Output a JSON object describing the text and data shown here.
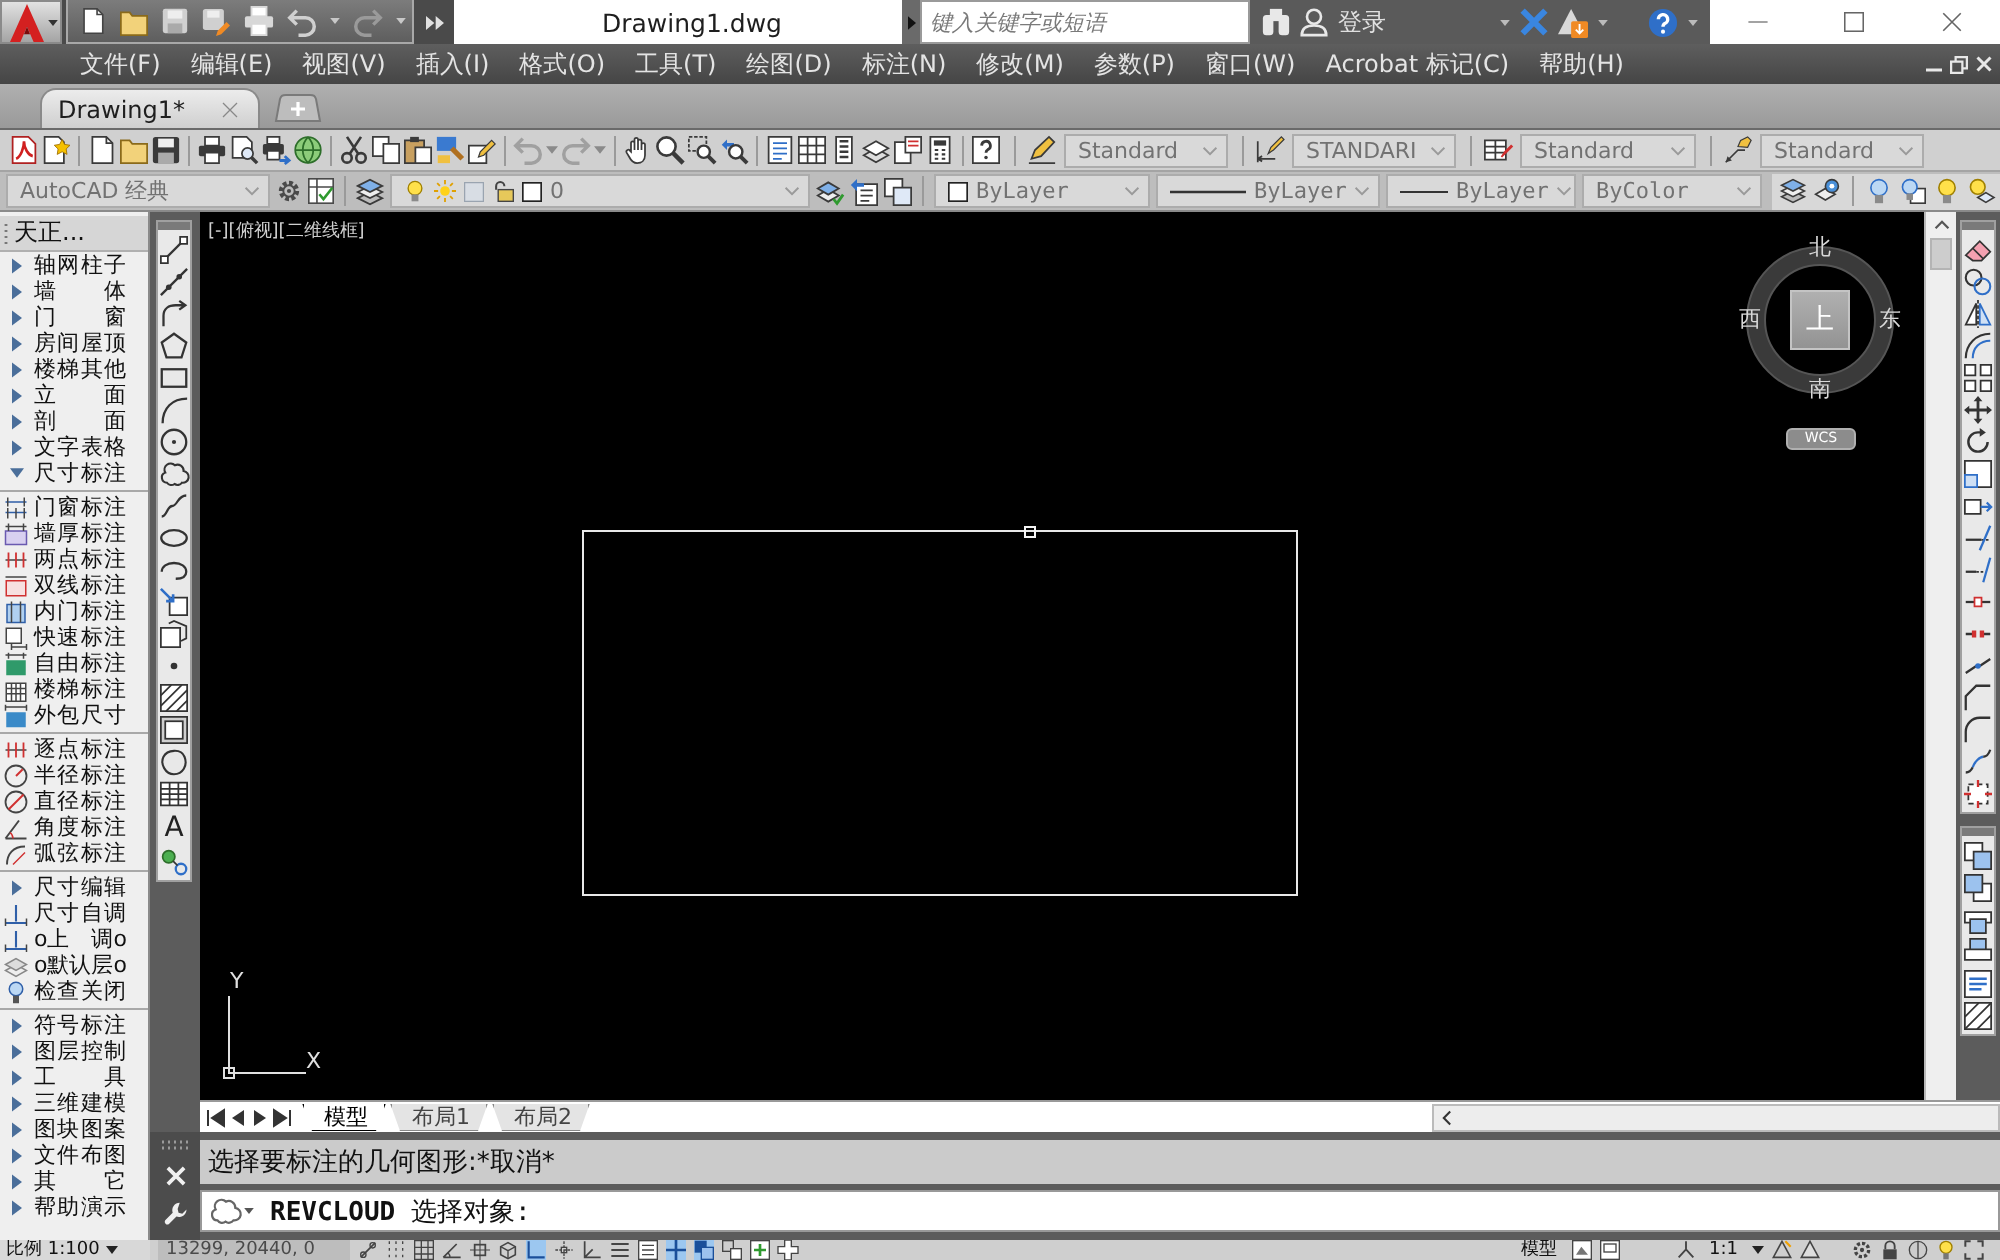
{
  "title_bar": {
    "document_title": "Drawing1.dwg",
    "search": {
      "placeholder": "键入关键字或短语"
    },
    "sign_in": "登录"
  },
  "menu_bar": [
    "文件(F)",
    "编辑(E)",
    "视图(V)",
    "插入(I)",
    "格式(O)",
    "工具(T)",
    "绘图(D)",
    "标注(N)",
    "修改(M)",
    "参数(P)",
    "窗口(W)",
    "Acrobat 标记(C)",
    "帮助(H)"
  ],
  "document_tabs": [
    {
      "label": "Drawing1*",
      "selected": true
    }
  ],
  "styles_toolbar": [
    {
      "kind": "text_style",
      "value": "Standard"
    },
    {
      "kind": "dimension_style",
      "value": "STANDARI"
    },
    {
      "kind": "table_style",
      "value": "Standard"
    },
    {
      "kind": "multileader_style",
      "value": "Standard"
    }
  ],
  "layers_toolbar": {
    "workspace": "AutoCAD 经典",
    "layer": "0",
    "color_setting": "ByLayer",
    "linetype": "ByLayer",
    "lineweight": "ByLayer",
    "plot_style": "ByColor"
  },
  "tianzheng_menu": {
    "title": "天正...",
    "items": [
      {
        "kind": "submenu",
        "label": "轴网柱子",
        "expanded": false
      },
      {
        "kind": "submenu",
        "label": "墙　体",
        "expanded": false
      },
      {
        "kind": "submenu",
        "label": "门　窗",
        "expanded": false
      },
      {
        "kind": "submenu",
        "label": "房间屋顶",
        "expanded": false
      },
      {
        "kind": "submenu",
        "label": "楼梯其他",
        "expanded": false
      },
      {
        "kind": "submenu",
        "label": "立　面",
        "expanded": false
      },
      {
        "kind": "submenu",
        "label": "剖　面",
        "expanded": false
      },
      {
        "kind": "submenu",
        "label": "文字表格",
        "expanded": false
      },
      {
        "kind": "submenu",
        "label": "尺寸标注",
        "expanded": true,
        "children": [
          {
            "kind": "command",
            "label": "门窗标注"
          },
          {
            "kind": "command",
            "label": "墙厚标注"
          },
          {
            "kind": "command",
            "label": "两点标注"
          },
          {
            "kind": "command",
            "label": "双线标注"
          },
          {
            "kind": "command",
            "label": "内门标注"
          },
          {
            "kind": "command",
            "label": "快速标注"
          },
          {
            "kind": "command",
            "label": "自由标注"
          },
          {
            "kind": "command",
            "label": "楼梯标注"
          },
          {
            "kind": "command",
            "label": "外包尺寸"
          },
          {
            "kind": "separator"
          },
          {
            "kind": "command",
            "label": "逐点标注"
          },
          {
            "kind": "command",
            "label": "半径标注"
          },
          {
            "kind": "command",
            "label": "直径标注"
          },
          {
            "kind": "command",
            "label": "角度标注"
          },
          {
            "kind": "command",
            "label": "弧弦标注"
          },
          {
            "kind": "separator"
          },
          {
            "kind": "submenu",
            "label": "尺寸编辑",
            "expanded": false
          },
          {
            "kind": "command",
            "label": "尺寸自调"
          },
          {
            "kind": "command",
            "label": "o上　调o"
          },
          {
            "kind": "command",
            "label": "o默认层o"
          },
          {
            "kind": "command",
            "label": "检查关闭"
          }
        ]
      },
      {
        "kind": "submenu",
        "label": "符号标注",
        "expanded": false
      },
      {
        "kind": "submenu",
        "label": "图层控制",
        "expanded": false
      },
      {
        "kind": "submenu",
        "label": "工　具",
        "expanded": false
      },
      {
        "kind": "submenu",
        "label": "三维建模",
        "expanded": false
      },
      {
        "kind": "submenu",
        "label": "图块图案",
        "expanded": false
      },
      {
        "kind": "submenu",
        "label": "文件布图",
        "expanded": false
      },
      {
        "kind": "submenu",
        "label": "其　它",
        "expanded": false
      },
      {
        "kind": "submenu",
        "label": "帮助演示",
        "expanded": false
      }
    ]
  },
  "draw_toolbar": {
    "text_tool": "A"
  },
  "viewport": {
    "label": "[-][俯视][二维线框]",
    "viewcube": {
      "face": "上",
      "north": "北",
      "south": "南",
      "east": "东",
      "west": "西",
      "coordinate_system": "WCS"
    },
    "ucs": {
      "x": "X",
      "y": "Y"
    }
  },
  "layout_tabs": [
    {
      "label": "模型",
      "selected": true
    },
    {
      "label": "布局1",
      "selected": false
    },
    {
      "label": "布局2",
      "selected": false
    }
  ],
  "command_line": {
    "history": "选择要标注的几何图形:*取消*",
    "input": "**REVCLOUD** 选择对象:"
  },
  "status_bar": {
    "scale": "比例 1:100",
    "coordinates": "13299, 20440, 0",
    "drafting_toggles": [
      {
        "on": false
      },
      {
        "on": false
      },
      {
        "on": false
      },
      {
        "on": false
      },
      {
        "on": false
      },
      {
        "on": false
      },
      {
        "on": true
      },
      {
        "on": false
      },
      {
        "on": false
      },
      {
        "on": false
      },
      {
        "on": false
      },
      {
        "on": true
      },
      {
        "on": true
      },
      {
        "on": false
      },
      {
        "on": false
      },
      {
        "on": false
      }
    ],
    "space": "模型",
    "annotation_scale": "1:1"
  }
}
